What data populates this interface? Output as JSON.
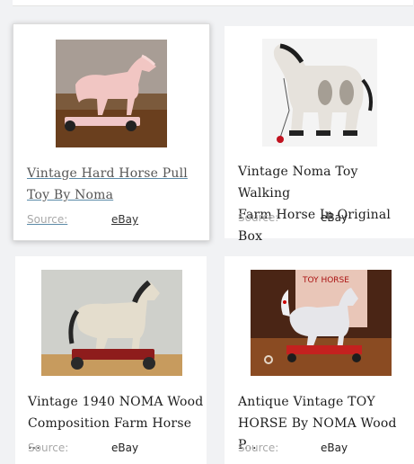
{
  "products": [
    {
      "title_line1": "Vintage Hard Horse Pull",
      "title_line2": "Toy By Noma",
      "source_label": "Source:",
      "source_value": "eBay",
      "image_icon": "horse-pull-toy-photo"
    },
    {
      "title_line1": "Vintage Noma Toy Walking",
      "title_line2": "Farm Horse In Original Box",
      "source_label": "Source:",
      "source_value": "eBay",
      "image_icon": "horse-walking-toy-photo"
    },
    {
      "title_line1": "Vintage 1940 NOMA Wood",
      "title_line2": "Composition Farm Horse ...",
      "source_label": "Source:",
      "source_value": "eBay",
      "image_icon": "horse-pull-toy-photo"
    },
    {
      "title_line1": "Antique Vintage TOY",
      "title_line2": "HORSE By NOMA Wood P...",
      "source_label": "Source:",
      "source_value": "eBay",
      "image_icon": "horse-pull-toy-photo"
    }
  ],
  "box_label": "TOY HORSE",
  "colors": {
    "background": "#f1f2f4",
    "card": "#ffffff",
    "link_underline": "#5a8aa8"
  }
}
